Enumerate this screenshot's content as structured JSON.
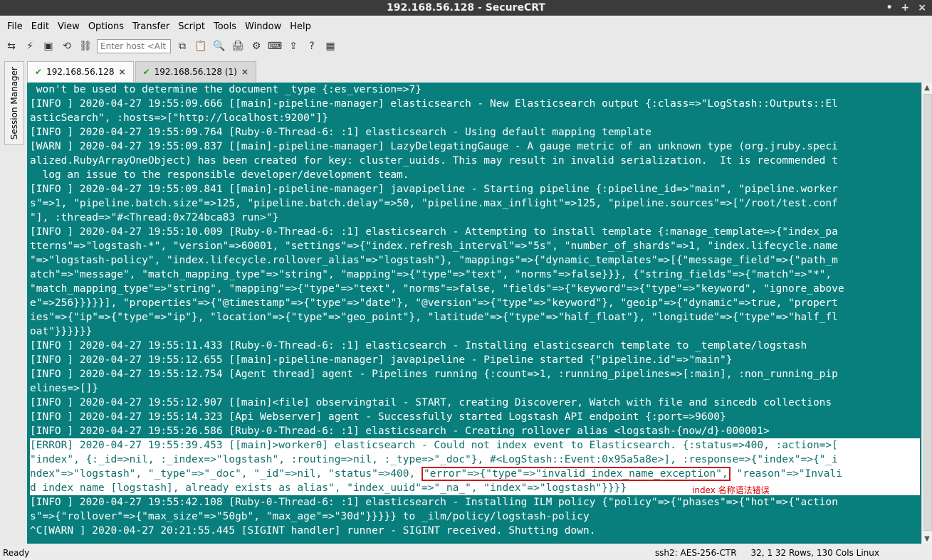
{
  "window": {
    "title": "192.168.56.128 - SecureCRT",
    "controls": [
      "•",
      "+",
      "×"
    ]
  },
  "menubar": [
    "File",
    "Edit",
    "View",
    "Options",
    "Transfer",
    "Script",
    "Tools",
    "Window",
    "Help"
  ],
  "toolbar": {
    "host_placeholder": "Enter host <Alt+R>",
    "icons": [
      "connect-icon",
      "quick-connect-icon",
      "tab-icon",
      "reconnect-icon",
      "link-icon",
      "copy-icon",
      "paste-icon",
      "find-icon",
      "print-icon",
      "options-icon",
      "keymap-icon",
      "sftp-icon",
      "help-icon",
      "app-icon"
    ]
  },
  "session_manager": {
    "label": "Session Manager"
  },
  "tabs": [
    {
      "label": "192.168.56.128",
      "active": true
    },
    {
      "label": "192.168.56.128 (1)",
      "active": false
    }
  ],
  "terminal": {
    "lines": [
      " won't be used to determine the document _type {:es_version=>7}",
      "[INFO ] 2020-04-27 19:55:09.666 [[main]-pipeline-manager] elasticsearch - New Elasticsearch output {:class=>\"LogStash::Outputs::El",
      "asticSearch\", :hosts=>[\"http://localhost:9200\"]}",
      "[INFO ] 2020-04-27 19:55:09.764 [Ruby-0-Thread-6: :1] elasticsearch - Using default mapping template",
      "[WARN ] 2020-04-27 19:55:09.837 [[main]-pipeline-manager] LazyDelegatingGauge - A gauge metric of an unknown type (org.jruby.speci",
      "alized.RubyArrayOneObject) has been created for key: cluster_uuids. This may result in invalid serialization.  It is recommended t",
      "  log an issue to the responsible developer/development team.",
      "[INFO ] 2020-04-27 19:55:09.841 [[main]-pipeline-manager] javapipeline - Starting pipeline {:pipeline_id=>\"main\", \"pipeline.worker",
      "s\"=>1, \"pipeline.batch.size\"=>125, \"pipeline.batch.delay\"=>50, \"pipeline.max_inflight\"=>125, \"pipeline.sources\"=>[\"/root/test.conf",
      "\"], :thread=>\"#<Thread:0x724bca83 run>\"}",
      "[INFO ] 2020-04-27 19:55:10.009 [Ruby-0-Thread-6: :1] elasticsearch - Attempting to install template {:manage_template=>{\"index_pa",
      "tterns\"=>\"logstash-*\", \"version\"=>60001, \"settings\"=>{\"index.refresh_interval\"=>\"5s\", \"number_of_shards\"=>1, \"index.lifecycle.name",
      "\"=>\"logstash-policy\", \"index.lifecycle.rollover_alias\"=>\"logstash\"}, \"mappings\"=>{\"dynamic_templates\"=>[{\"message_field\"=>{\"path_m",
      "atch\"=>\"message\", \"match_mapping_type\"=>\"string\", \"mapping\"=>{\"type\"=>\"text\", \"norms\"=>false}}}, {\"string_fields\"=>{\"match\"=>\"*\",",
      "\"match_mapping_type\"=>\"string\", \"mapping\"=>{\"type\"=>\"text\", \"norms\"=>false, \"fields\"=>{\"keyword\"=>{\"type\"=>\"keyword\", \"ignore_above",
      "e\"=>256}}}}}], \"properties\"=>{\"@timestamp\"=>{\"type\"=>\"date\"}, \"@version\"=>{\"type\"=>\"keyword\"}, \"geoip\"=>{\"dynamic\"=>true, \"propert",
      "ies\"=>{\"ip\"=>{\"type\"=>\"ip\"}, \"location\"=>{\"type\"=>\"geo_point\"}, \"latitude\"=>{\"type\"=>\"half_float\"}, \"longitude\"=>{\"type\"=>\"half_fl",
      "oat\"}}}}}}",
      "[INFO ] 2020-04-27 19:55:11.433 [Ruby-0-Thread-6: :1] elasticsearch - Installing elasticsearch template to _template/logstash",
      "[INFO ] 2020-04-27 19:55:12.655 [[main]-pipeline-manager] javapipeline - Pipeline started {\"pipeline.id\"=>\"main\"}",
      "[INFO ] 2020-04-27 19:55:12.754 [Agent thread] agent - Pipelines running {:count=>1, :running_pipelines=>[:main], :non_running_pip",
      "elines=>[]}",
      "[INFO ] 2020-04-27 19:55:12.907 [[main]<file] observingtail - START, creating Discoverer, Watch with file and sincedb collections",
      "[INFO ] 2020-04-27 19:55:14.323 [Api Webserver] agent - Successfully started Logstash API endpoint {:port=>9600}",
      "[INFO ] 2020-04-27 19:55:26.586 [Ruby-0-Thread-6: :1] elasticsearch - Creating rollover alias <logstash-{now/d}-000001>",
      "[ERROR] 2020-04-27 19:55:39.453 [[main]>worker0] elasticsearch - Could not index event to Elasticsearch. {:status=>400, :action=>[",
      "\"index\", {:_id=>nil, :_index=>\"logstash\", :routing=>nil, :_type=>\"_doc\"}, #<LogStash::Event:0x95a5a8e>], :response=>{\"index\"=>{\"_i",
      "ndex\"=>\"logstash\", \"_type\"=>\"_doc\", \"_id\"=>nil, \"status\"=>400, ",
      "d index name [logstash], already exists as alias\", \"index_uuid\"=>\"_na_\", \"index\"=>\"logstash\"}}}}",
      "[INFO ] 2020-04-27 19:55:42.108 [Ruby-0-Thread-6: :1] elasticsearch - Installing ILM policy {\"policy\"=>{\"phases\"=>{\"hot\"=>{\"action",
      "s\"=>{\"rollover\"=>{\"max_size\"=>\"50gb\", \"max_age\"=>\"30d\"}}}}} to _ilm/policy/logstash-policy",
      "^C[WARN ] 2020-04-27 20:21:55.445 [SIGINT handler] runner - SIGINT received. Shutting down."
    ],
    "error_highlight": "\"error\"=>{\"type\"=>\"invalid_index_name_exception\",",
    "error_rest": " \"reason\"=>\"Invali",
    "annotation": "index 名称语法错误"
  },
  "statusbar": {
    "left": "Ready",
    "right": [
      "ssh2: AES-256-CTR",
      "32,  1  32 Rows, 130 Cols  Linux"
    ]
  },
  "colors": {
    "terminal_bg": "#087f7d",
    "terminal_fg": "#ffffff",
    "error_bg": "#ffffff",
    "error_fg": "#0f6f6e",
    "highlight": "#cc1a1a"
  }
}
